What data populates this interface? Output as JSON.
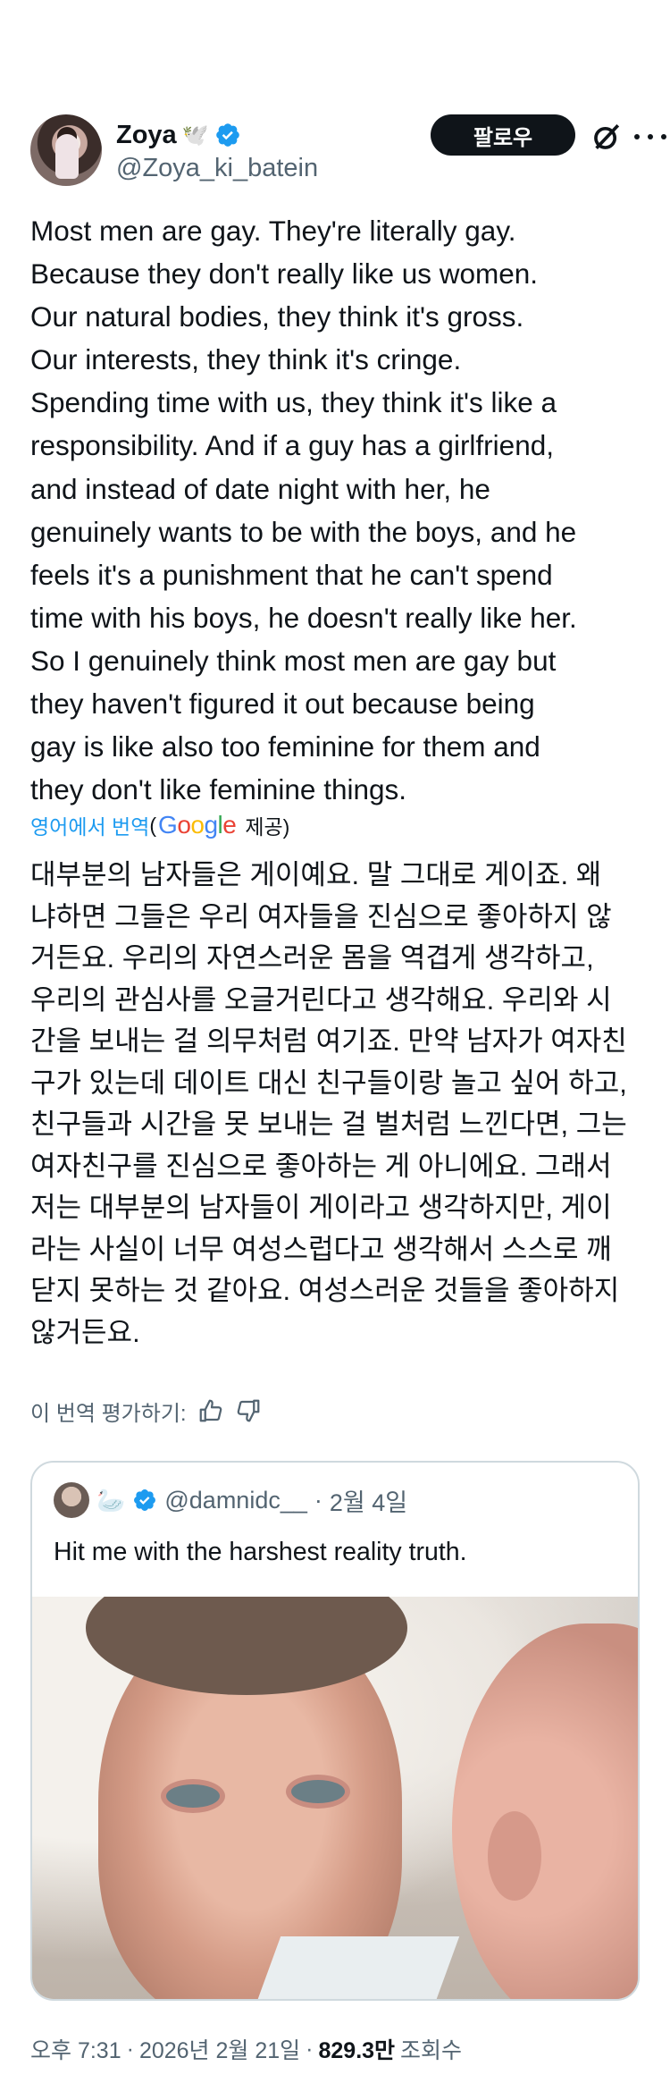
{
  "author": {
    "name": "Zoya",
    "badge_emoji": "🕊️",
    "handle": "@Zoya_ki_batein",
    "verified_icon": "verified-badge-icon",
    "accent_color": "#1d9bf0"
  },
  "actions": {
    "follow_label": "팔로우",
    "grok_icon": "grok-icon",
    "more_icon": "more-icon"
  },
  "post": {
    "text": "Most men are gay. They're literally gay.\nBecause they don't really like us women.\nOur natural bodies, they think it's gross.\nOur interests, they think it's cringe.\nSpending time with us, they think it's like a\nresponsibility. And if a guy has a girlfriend,\nand instead of date night with her, he\ngenuinely wants to be with the boys, and he\nfeels it's a punishment that he can't spend\ntime with his boys, he doesn't really like her.\nSo I genuinely think most men are gay but\nthey haven't figured it out because being\ngay is like also too feminine for them and\nthey don't like feminine things."
  },
  "translation": {
    "link_label": "영어에서 번역",
    "open_paren": "(",
    "provider": "Google",
    "provided_label": "제공)",
    "text": "대부분의 남자들은 게이예요. 말 그대로 게이죠. 왜\n냐하면 그들은 우리 여자들을 진심으로 좋아하지 않\n거든요. 우리의 자연스러운 몸을 역겹게 생각하고,\n우리의 관심사를 오글거린다고 생각해요. 우리와 시\n간을 보내는 걸 의무처럼 여기죠. 만약 남자가 여자친\n구가 있는데 데이트 대신 친구들이랑 놀고 싶어 하고,\n친구들과 시간을 못 보내는 걸 벌처럼 느낀다면, 그는\n여자친구를 진심으로 좋아하는 게 아니에요. 그래서\n저는 대부분의 남자들이 게이라고 생각하지만, 게이\n라는 사실이 너무 여성스럽다고 생각해서 스스로 깨\n닫지 못하는 것 같아요. 여성스러운 것들을 좋아하지\n않거든요.",
    "rate_label": "이 번역 평가하기:"
  },
  "quote": {
    "emoji": "🦢",
    "handle": "@damnidc__",
    "separator": "·",
    "date": "2월 4일",
    "text": "Hit me with the harshest reality truth."
  },
  "meta": {
    "time": "오후 7:31",
    "separator": "·",
    "date": "2026년 2월 21일",
    "views_count": "829.3만",
    "views_label": "조회수"
  }
}
